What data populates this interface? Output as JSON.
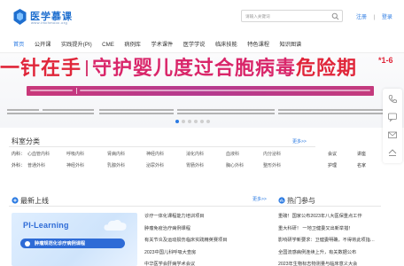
{
  "header": {
    "logo_title": "医学慕课",
    "logo_subtitle": "www.imchmooc.org",
    "search_placeholder": "请输入关键词",
    "register": "注册",
    "separator": "|",
    "login": "登录"
  },
  "nav": {
    "items": [
      "首页",
      "公开课",
      "实践提升(PI)",
      "CME",
      "病例库",
      "学术课件",
      "医学学说",
      "临床技能",
      "特色课程",
      "知识图谱"
    ],
    "active_index": 0
  },
  "banner": {
    "title_part1": "一针在手",
    "title_part2": "守护婴儿度过",
    "title_part3": "合胞病毒",
    "title_part4": "危险期",
    "aside": "*1-6",
    "slide_count": 6,
    "active_slide": 0
  },
  "departments": {
    "title": "科室分类",
    "more": "更多>>",
    "rows": [
      {
        "label": "内科：",
        "items": [
          "心血管内科",
          "呼吸内科",
          "肾病内科",
          "神经内科",
          "消化内科",
          "血液科",
          "内分泌科"
        ]
      },
      {
        "label": "外科：",
        "items": [
          "普通外科",
          "神经外科",
          "乳腺外科",
          "泌尿外科",
          "胃肠外科",
          "胸心外科",
          "整形外科"
        ]
      }
    ],
    "side_rows": [
      [
        "会议",
        "讲座"
      ],
      [
        "护理",
        "名家"
      ]
    ]
  },
  "latest": {
    "title": "最新上线",
    "more": "更多>>",
    "card_brand": "PI-Learning",
    "card_caption": "肿瘤规范化诊疗病例课程",
    "items": [
      "诊疗一体化课程能力培训项目",
      "肿瘤免疫治疗病例课程",
      "有关节炎及运动损伤临床实践精英赛项目",
      "2023中国儿科呼吸大查房",
      "中华医学会肝病学术会议"
    ]
  },
  "hot": {
    "title": "热门参与",
    "items": [
      "重磅！国家公布2023年八大医保重点工作",
      "重大科研！ 一地卫健委又出新举措！",
      "影响研学新要求：卫健委明确，不得将此项指…",
      "全国流感病例连续上升，有关数据公布",
      "2023年生物标志物测量与临床意义大会"
    ]
  },
  "colors": {
    "brand_blue": "#2a7ae2",
    "banner_red": "#e0263a",
    "banner_pink": "#d9266a",
    "banner_band": "#c9387a"
  }
}
